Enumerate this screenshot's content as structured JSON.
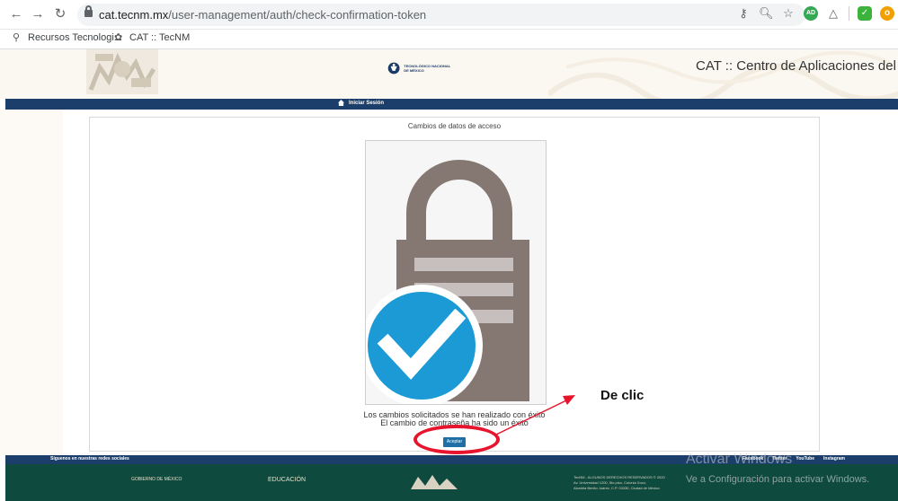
{
  "browser": {
    "url_host": "cat.tecnm.mx",
    "url_path": "/user-management/auth/check-confirmation-token",
    "bookmarks": [
      {
        "label": "Recursos Tecnologi..."
      },
      {
        "label": "CAT :: TecNM"
      }
    ],
    "extension_badge": "AD"
  },
  "header": {
    "logo_text": "TECNOLÓGICO NACIONAL DE MÉXICO",
    "site_title": "CAT :: Centro de Aplicaciones del TecNM",
    "nav_login": "Iniciar Sesión"
  },
  "panel": {
    "title": "Cambios de datos de acceso",
    "message_line1": "Los cambios solicitados se han realizado con éxito",
    "message_line2": "El cambio de contraseña ha sido un éxito",
    "accept_label": "Aceptar"
  },
  "annotation": {
    "text": "De clic"
  },
  "footer": {
    "follow_text": "Síguenos en nuestras redes sociales",
    "socials": [
      "Facebook",
      "Twitter",
      "YouTube",
      "Instagram"
    ],
    "gob_label": "GOBIERNO DE MÉXICO",
    "edu_label": "EDUCACIÓN",
    "copyright_line1": "TecNM - ALGUNOS DERECHOS RESERVADOS © 2020",
    "copyright_line2": "Av. Universidad 1200, 5to piso, Colonia Xoco,",
    "copyright_line3": "Alcaldía Benito Juárez, C.P. 03330, Ciudad de México"
  },
  "watermark": {
    "line1": "Activar Windows",
    "line2": "Ve a Configuración para activar Windows."
  },
  "colors": {
    "navy": "#1b3f6a",
    "footer_green": "#0f4a3e",
    "accent_red": "#e8132d",
    "check_blue": "#1b9ad6"
  }
}
